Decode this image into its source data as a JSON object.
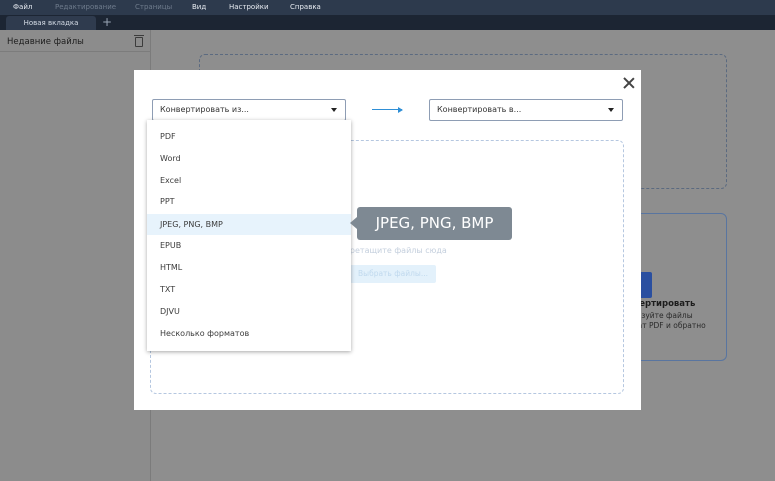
{
  "menu": {
    "items": [
      {
        "label": "Файл",
        "enabled": true
      },
      {
        "label": "Редактирование",
        "enabled": false
      },
      {
        "label": "Страницы",
        "enabled": false
      },
      {
        "label": "Вид",
        "enabled": true
      },
      {
        "label": "Настройки",
        "enabled": true
      },
      {
        "label": "Справка",
        "enabled": true
      }
    ]
  },
  "tabs": {
    "active": "Новая вкладка",
    "add_icon": "plus-icon"
  },
  "sidebar": {
    "title": "Недавние файлы",
    "clear_icon": "trash-icon"
  },
  "background": {
    "card_title": "нвертировать",
    "card_sub_1": "разуйте файлы",
    "card_sub_2": "мат PDF и обратно"
  },
  "dialog": {
    "from_placeholder": "Конвертировать из...",
    "to_placeholder": "Конвертировать в...",
    "drop_hint": "еретащите файлы сюда",
    "select_button": "Выбрать файлы...",
    "close_icon": "close-icon",
    "arrow_color": "#2f8fd6"
  },
  "dropdown": {
    "options": [
      "PDF",
      "Word",
      "Excel",
      "PPT",
      "JPEG, PNG, BMP",
      "EPUB",
      "HTML",
      "TXT",
      "DJVU",
      "Несколько форматов"
    ],
    "highlighted": "JPEG, PNG, BMP"
  },
  "tooltip": {
    "text": "JPEG, PNG, BMP"
  }
}
